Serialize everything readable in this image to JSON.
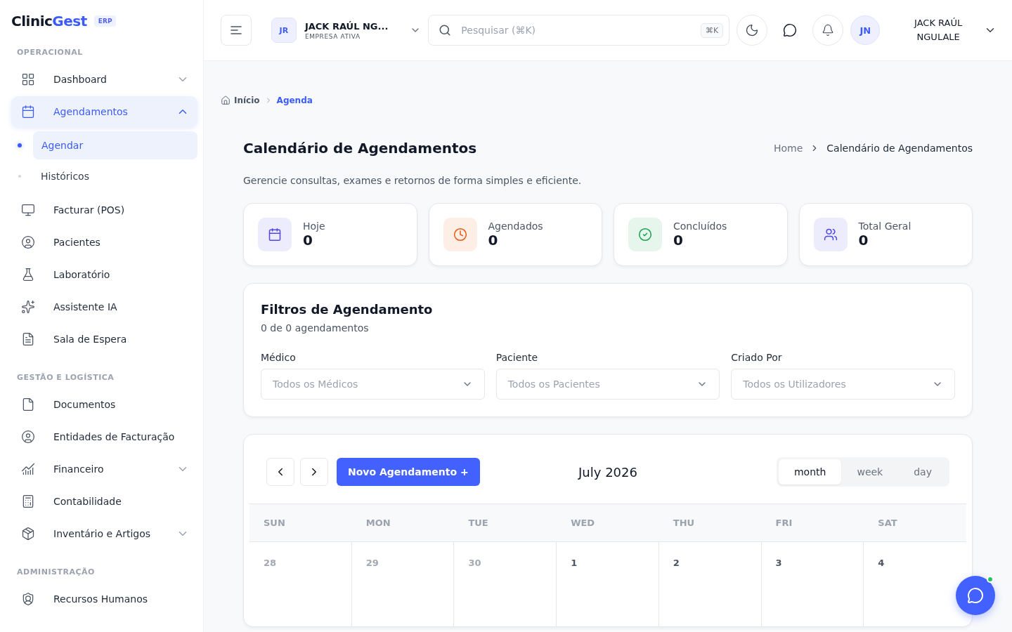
{
  "brand": {
    "name_dark": "Clinic",
    "name_accent": "Gest",
    "badge": "ERP"
  },
  "sidebar": {
    "sections": [
      {
        "title": "OPERACIONAL",
        "items": [
          {
            "label": "Dashboard",
            "kind": "group",
            "expanded": false,
            "selected": false
          },
          {
            "label": "Agendamentos",
            "kind": "group",
            "expanded": true,
            "selected": true,
            "children": [
              {
                "label": "Agendar",
                "selected": true
              },
              {
                "label": "Históricos",
                "selected": false
              }
            ]
          },
          {
            "label": "Facturar (POS)",
            "kind": "link",
            "selected": false
          },
          {
            "label": "Pacientes",
            "kind": "link",
            "selected": false
          },
          {
            "label": "Laboratório",
            "kind": "link",
            "selected": false
          },
          {
            "label": "Assistente IA",
            "kind": "link",
            "selected": false
          },
          {
            "label": "Sala de Espera",
            "kind": "link",
            "selected": false
          }
        ]
      },
      {
        "title": "GESTÃO E LOGÍSTICA",
        "items": [
          {
            "label": "Documentos",
            "kind": "link",
            "selected": false
          },
          {
            "label": "Entidades de Facturação",
            "kind": "link",
            "selected": false
          },
          {
            "label": "Financeiro",
            "kind": "group",
            "expanded": false,
            "selected": false
          },
          {
            "label": "Contabilidade",
            "kind": "link",
            "selected": false
          },
          {
            "label": "Inventário e Artigos",
            "kind": "group",
            "expanded": false,
            "selected": false
          }
        ]
      },
      {
        "title": "ADMINISTRAÇÃO",
        "items": [
          {
            "label": "Recursos Humanos",
            "kind": "link",
            "selected": false
          }
        ]
      }
    ]
  },
  "topbar": {
    "company": {
      "initials": "JR",
      "name": "JACK RAÚL NG...",
      "subtitle": "EMPRESA ATIVA"
    },
    "search": {
      "placeholder": "Pesquisar (⌘K)",
      "shortcut": "⌘K"
    },
    "user": {
      "initials": "JN",
      "name": "JACK RAÚL NGULALE"
    }
  },
  "breadcrumb": [
    {
      "label": "Início",
      "selected": false
    },
    {
      "label": "Agenda",
      "selected": true
    }
  ],
  "page": {
    "title": "Calendário de Agendamentos",
    "trail": [
      "Home",
      "Calendário de Agendamentos"
    ],
    "description": "Gerencie consultas, exames e retornos de forma simples e eficiente."
  },
  "stats": [
    {
      "label": "Hoje",
      "value": "0",
      "color": "#4f46e5"
    },
    {
      "label": "Agendados",
      "value": "0",
      "color": "#ea580c"
    },
    {
      "label": "Concluídos",
      "value": "0",
      "color": "#16a34a"
    },
    {
      "label": "Total Geral",
      "value": "0",
      "color": "#4f46e5"
    }
  ],
  "filters": {
    "title": "Filtros de Agendamento",
    "count": "0 de 0 agendamentos",
    "fields": [
      {
        "label": "Médico",
        "placeholder": "Todos os Médicos"
      },
      {
        "label": "Paciente",
        "placeholder": "Todos os Pacientes"
      },
      {
        "label": "Criado Por",
        "placeholder": "Todos os Utilizadores"
      }
    ]
  },
  "calendar": {
    "new_button": "Novo Agendamento +",
    "title": "July 2026",
    "views": [
      {
        "label": "month",
        "selected": true
      },
      {
        "label": "week",
        "selected": false
      },
      {
        "label": "day",
        "selected": false
      }
    ],
    "weekdays": [
      "SUN",
      "MON",
      "TUE",
      "WED",
      "THU",
      "FRI",
      "SAT"
    ],
    "days": [
      {
        "label": "28",
        "muted": true
      },
      {
        "label": "29",
        "muted": true
      },
      {
        "label": "30",
        "muted": true
      },
      {
        "label": "1",
        "muted": false
      },
      {
        "label": "2",
        "muted": false
      },
      {
        "label": "3",
        "muted": false
      },
      {
        "label": "4",
        "muted": false
      }
    ]
  }
}
